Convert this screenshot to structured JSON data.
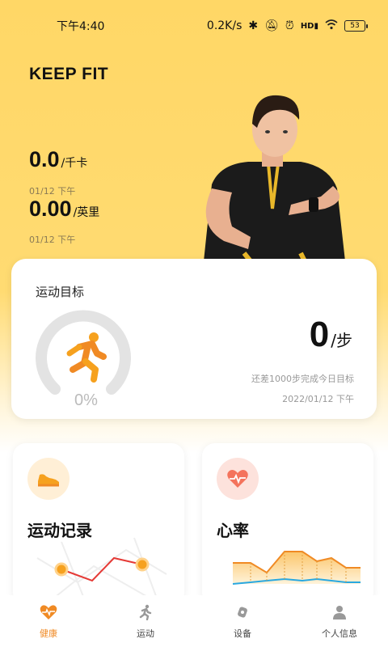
{
  "status_bar": {
    "time": "下午4:40",
    "network_speed": "0.2K/s",
    "battery": "53",
    "icons": [
      "bluetooth-icon",
      "mute-icon",
      "alarm-icon",
      "hd-signal-icon",
      "wifi-icon",
      "battery-icon"
    ]
  },
  "header": {
    "title": "KEEP FIT"
  },
  "stats": {
    "calories": {
      "value": "0.0",
      "unit": "/千卡",
      "date": "01/12 下午"
    },
    "distance": {
      "value": "0.00",
      "unit": "/英里",
      "date": "01/12 下午"
    }
  },
  "goal_card": {
    "title": "运动目标",
    "percent": "0%",
    "steps_value": "0",
    "steps_unit": "/步",
    "remaining_text": "还差1000步完成今日目标",
    "date": "2022/01/12 下午",
    "progress_fraction": 0
  },
  "features": [
    {
      "title": "运动记录",
      "icon": "shoe-icon"
    },
    {
      "title": "心率",
      "icon": "heart-rate-icon"
    }
  ],
  "bottom_nav": [
    {
      "label": "健康",
      "icon": "heart-pulse-icon",
      "active": true
    },
    {
      "label": "运动",
      "icon": "running-icon",
      "active": false
    },
    {
      "label": "设备",
      "icon": "device-icon",
      "active": false
    },
    {
      "label": "个人信息",
      "icon": "person-icon",
      "active": false
    }
  ],
  "colors": {
    "accent": "#F08A24",
    "background_yellow": "#FFD766",
    "gauge_track": "#E3E3E3"
  }
}
